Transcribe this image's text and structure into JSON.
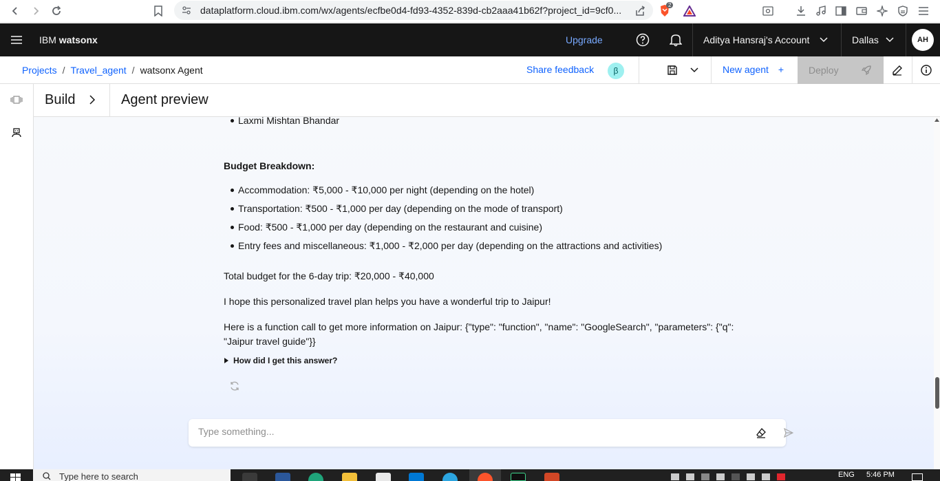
{
  "browser": {
    "url": "dataplatform.cloud.ibm.com/wx/agents/ecfbe0d4-fd93-4352-839d-cb2aaa41b62f?project_id=9cf0...",
    "brave_badge_count": "2"
  },
  "header": {
    "brand_prefix": "IBM ",
    "brand_name": "watsonx",
    "upgrade_label": "Upgrade",
    "account_label": "Aditya Hansraj's Account",
    "region_label": "Dallas",
    "avatar_initials": "AH"
  },
  "breadcrumb": {
    "items": [
      "Projects",
      "Travel_agent",
      "watsonx Agent"
    ],
    "separator": "/"
  },
  "toolbar": {
    "share_feedback": "Share feedback",
    "beta_badge": "β",
    "new_agent": "New agent",
    "new_agent_plus": "+",
    "deploy": "Deploy"
  },
  "panel": {
    "build_label": "Build",
    "preview_title": "Agent preview"
  },
  "chat": {
    "partial_item": "Laxmi Mishtan Bhandar",
    "budget_heading": "Budget Breakdown:",
    "budget_items": [
      "Accommodation: ₹5,000 - ₹10,000 per night (depending on the hotel)",
      "Transportation: ₹500 - ₹1,000 per day (depending on the mode of transport)",
      "Food: ₹500 - ₹1,000 per day (depending on the restaurant and cuisine)",
      "Entry fees and miscellaneous: ₹1,000 - ₹2,000 per day (depending on the attractions and activities)"
    ],
    "total_budget": "Total budget for the 6-day trip: ₹20,000 - ₹40,000",
    "closing": "I hope this personalized travel plan helps you have a wonderful trip to Jaipur!",
    "function_call_line1": "Here is a function call to get more information on Jaipur: {\"type\": \"function\", \"name\": \"GoogleSearch\", \"parameters\": {\"q\":",
    "function_call_line2": "\"Jaipur travel guide\"}}",
    "how_did_i": "How did I get this answer?",
    "input_placeholder": "Type something..."
  },
  "taskbar": {
    "search_placeholder": "Type here to search",
    "lang": "ENG",
    "time": "5:46 PM"
  },
  "colors": {
    "ibm_blue": "#0f62fe",
    "header_bg": "#161616",
    "upgrade_link": "#78a9ff",
    "deploy_disabled": "#c6c6c6",
    "beta_bg": "#9ef0f0"
  }
}
